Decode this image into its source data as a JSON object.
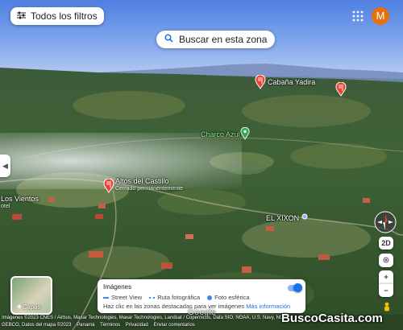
{
  "toolbar": {
    "filters_label": "Todos los filtros",
    "search_here_label": "Buscar en esta zona",
    "avatar_initial": "M"
  },
  "places": [
    {
      "name": "Cabaña Yadira",
      "icon": "restaurant-pin-icon"
    },
    {
      "name": "Charco Azul",
      "icon": "park-pin-icon"
    },
    {
      "name": "Altos del Castillo",
      "status": "Cerrado permanentemente",
      "icon": "restaurant-pin-icon"
    },
    {
      "name": "EL XIXON",
      "icon": "dot-marker-icon"
    },
    {
      "name": "Los Vientos",
      "sub": "otel"
    }
  ],
  "controls": {
    "tilt_label": "2D",
    "zoom_in": "+",
    "zoom_out": "−"
  },
  "layers": {
    "label": "Capas"
  },
  "imagery_panel": {
    "title": "Imágenes",
    "street_view": "Street View",
    "photo_route": "Ruta fotográfica",
    "spherical": "Foto esférica",
    "hint": "Haz clic en las zonas destacadas para ver imágenes",
    "more_info": "Más información"
  },
  "attribution": {
    "line1": "Imágenes ©2023 CNES / Airbus, Maxar Technologies, Maxar Technologies, Landsat / Copernicus, Data SIO, NOAA, U.S. Navy, NGA,",
    "line2_items": [
      "GEBCO, Datos del mapa ©2023",
      "Panamá",
      "Términos",
      "Privacidad",
      "Enviar comentarios"
    ],
    "google": "Google"
  },
  "watermark": "BuscoCasita.com",
  "colors": {
    "pin_red": "#ea4335",
    "pin_green": "#34a853",
    "accent_blue": "#1a73e8",
    "avatar": "#e8710a"
  }
}
